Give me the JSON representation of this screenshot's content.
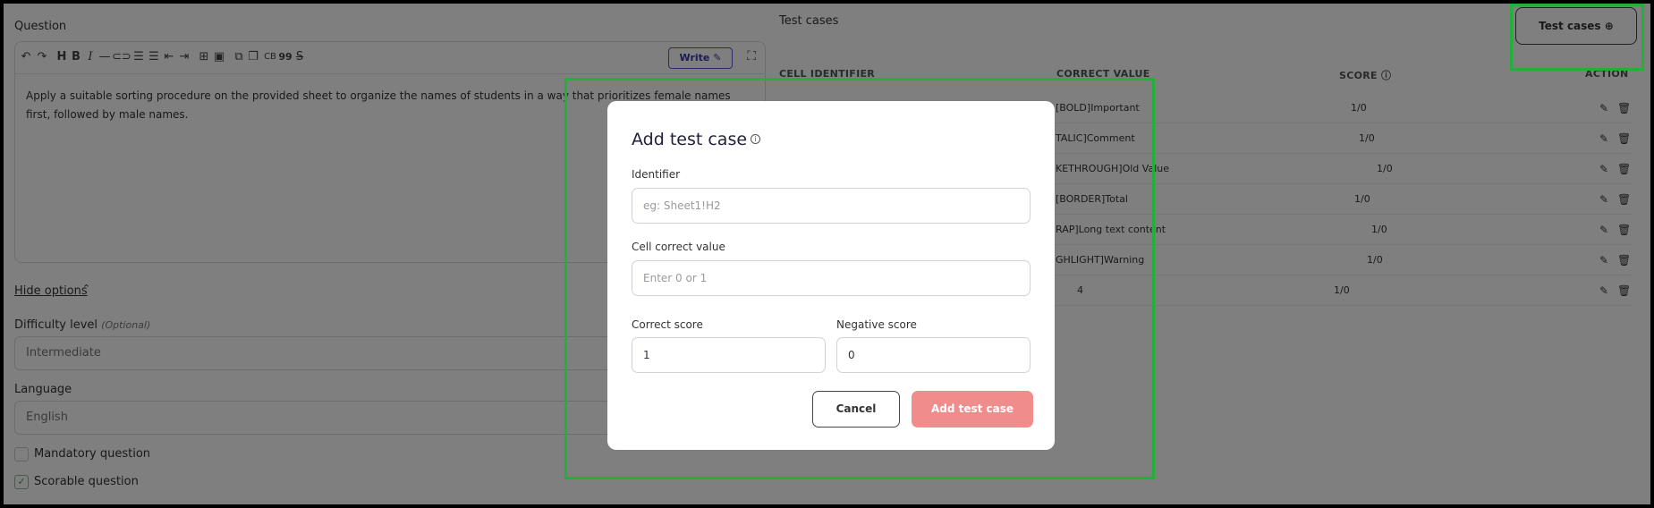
{
  "question": {
    "label": "Question",
    "toolbar": {
      "write_label": "Write",
      "icons": [
        "undo-icon",
        "redo-icon",
        "heading-icon",
        "bold-icon",
        "italic-icon",
        "horizontal-rule-icon",
        "link-icon",
        "ordered-list-icon",
        "bullet-list-icon",
        "outdent-icon",
        "indent-icon",
        "table-icon",
        "image-icon",
        "code-icon",
        "copy-icon",
        "code-block-icon",
        "quote-icon",
        "strikethrough-icon"
      ],
      "code_block_label": "CB",
      "quote_label": "99"
    },
    "text": "Apply a suitable sorting procedure on the provided sheet to organize the names of students in a way that prioritizes female names first, followed by male names."
  },
  "options": {
    "hide_label": "Hide options",
    "difficulty_label": "Difficulty level",
    "difficulty_optional": "(Optional)",
    "difficulty_value": "Intermediate",
    "language_label": "Language",
    "language_value": "English",
    "mandatory_label": "Mandatory question",
    "mandatory_checked": false,
    "scorable_label": "Scorable question",
    "scorable_checked": true
  },
  "test_cases": {
    "title": "Test cases",
    "button_label": "Test cases",
    "columns": {
      "identifier": "CELL IDENTIFIER",
      "value": "CORRECT VALUE",
      "score": "SCORE",
      "action": "ACTION"
    },
    "rows": [
      {
        "value": "[BOLD]Important",
        "score": "1/0"
      },
      {
        "value": "TALIC]Comment",
        "score": "1/0"
      },
      {
        "value": "KETHROUGH]Old Value",
        "score": "1/0"
      },
      {
        "value": "[BORDER]Total",
        "score": "1/0"
      },
      {
        "value": "RAP]Long text content",
        "score": "1/0"
      },
      {
        "value": "GHLIGHT]Warning",
        "score": "1/0"
      },
      {
        "value": "4",
        "score": "1/0"
      }
    ]
  },
  "modal": {
    "title": "Add test case",
    "identifier_label": "Identifier",
    "identifier_placeholder": "eg: Sheet1!H2",
    "cell_value_label": "Cell correct value",
    "cell_value_placeholder": "Enter 0 or 1",
    "correct_score_label": "Correct score",
    "correct_score_value": "1",
    "negative_score_label": "Negative score",
    "negative_score_value": "0",
    "cancel_label": "Cancel",
    "add_label": "Add test case"
  },
  "colors": {
    "highlight": "#22b03a",
    "primary_button": "#ef8c8c",
    "write_accent": "#5b57c7"
  }
}
